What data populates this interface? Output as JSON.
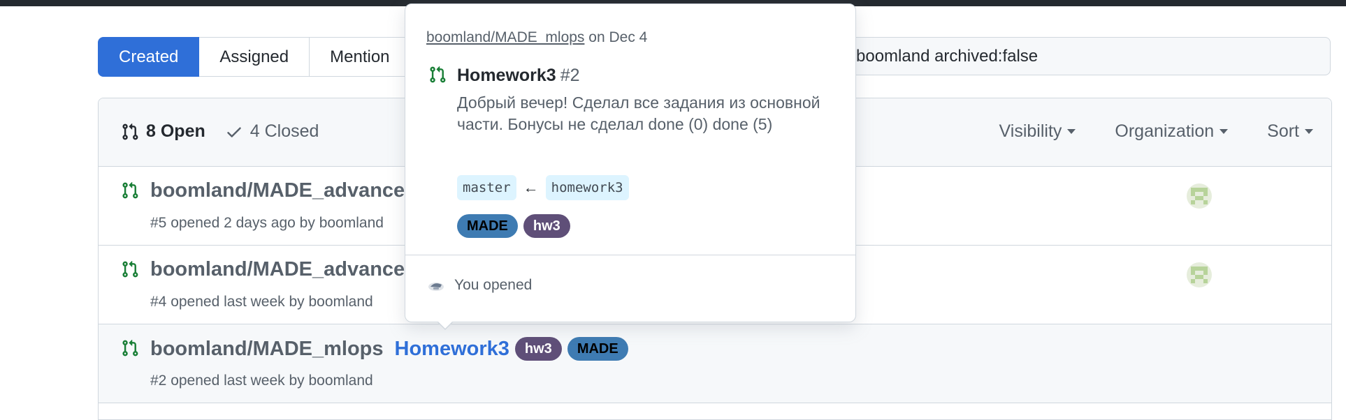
{
  "subnav": {
    "items": [
      {
        "label": "Created",
        "selected": true
      },
      {
        "label": "Assigned",
        "selected": false
      },
      {
        "label": "Mention",
        "selected": false
      }
    ]
  },
  "search": {
    "value": "boomland archived:false"
  },
  "list": {
    "open_label": "8 Open",
    "closed_label": "4 Closed",
    "filters": [
      "Visibility",
      "Organization",
      "Sort"
    ],
    "rows": [
      {
        "repo": "boomland/MADE_advanced",
        "title": "",
        "labels": [],
        "meta": "#5 opened 2 days ago by boomland"
      },
      {
        "repo": "boomland/MADE_advanced",
        "title": "",
        "labels": [],
        "meta": "#4 opened last week by boomland"
      },
      {
        "repo": "boomland/MADE_mlops",
        "title": "Homework3",
        "labels": [
          "hw3",
          "MADE"
        ],
        "meta": "#2 opened last week by boomland"
      }
    ]
  },
  "hovercard": {
    "repo": "boomland/MADE_mlops",
    "date_text": "on Dec 4",
    "title": "Homework3",
    "number": "#2",
    "body": "Добрый вечер! Сделал все задания из основной части. Бонусы не сделал done (0) done (5)",
    "base_branch": "master",
    "head_branch": "homework3",
    "labels": [
      "MADE",
      "hw3"
    ],
    "footer": "You opened"
  },
  "colors": {
    "accent": "#2f6fd8",
    "open_green": "#1a7f37",
    "label_hw3": "#5f4f78",
    "label_made": "#3e7bb2"
  }
}
